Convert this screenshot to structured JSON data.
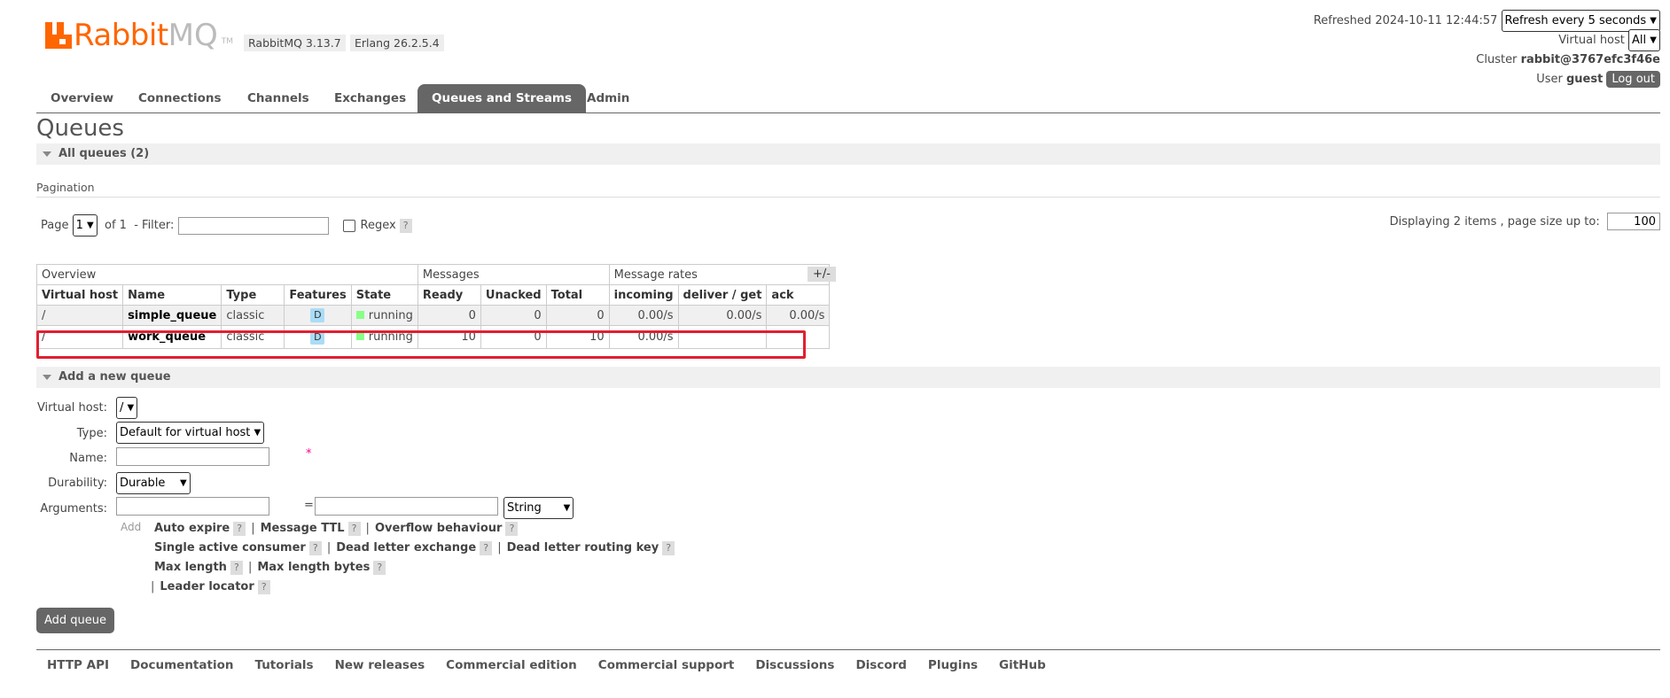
{
  "header": {
    "brand_rabbit": "Rabbit",
    "brand_mq": "MQ",
    "brand_tm": "TM",
    "rabbitmq_version": "RabbitMQ 3.13.7",
    "erlang_version": "Erlang 26.2.5.4",
    "refreshed_label": "Refreshed",
    "refreshed_time": "2024-10-11 12:44:57",
    "refresh_select": "Refresh every 5 seconds",
    "vhost_label": "Virtual host",
    "vhost_select": "All",
    "cluster_label": "Cluster",
    "cluster_name": "rabbit@3767efc3f46e",
    "user_label": "User",
    "user_name": "guest",
    "logout_label": "Log out"
  },
  "tabs": [
    {
      "label": "Overview"
    },
    {
      "label": "Connections"
    },
    {
      "label": "Channels"
    },
    {
      "label": "Exchanges"
    },
    {
      "label": "Queues and Streams",
      "active": true
    },
    {
      "label": "Admin"
    }
  ],
  "page_title": "Queues",
  "all_queues": {
    "label": "All queues (2)"
  },
  "pagination": {
    "title": "Pagination",
    "page_label": "Page",
    "page_value": "1",
    "of_label": "of 1",
    "filter_label": "- Filter:",
    "filter_value": "",
    "regex_label": "Regex",
    "help": "?",
    "displaying_label": "Displaying 2 items , page size up to:",
    "page_size": "100"
  },
  "table": {
    "groups": [
      "Overview",
      "Messages",
      "Message rates"
    ],
    "columns": [
      "Virtual host",
      "Name",
      "Type",
      "Features",
      "State",
      "Ready",
      "Unacked",
      "Total",
      "incoming",
      "deliver / get",
      "ack"
    ],
    "toggle": "+/-",
    "rows": [
      {
        "vhost": "/",
        "name": "simple_queue",
        "type": "classic",
        "feature": "D",
        "state": "running",
        "ready": "0",
        "unacked": "0",
        "total": "0",
        "incoming": "0.00/s",
        "deliver": "0.00/s",
        "ack": "0.00/s"
      },
      {
        "vhost": "/",
        "name": "work_queue",
        "type": "classic",
        "feature": "D",
        "state": "running",
        "ready": "10",
        "unacked": "0",
        "total": "10",
        "incoming": "0.00/s",
        "deliver": "",
        "ack": ""
      }
    ]
  },
  "add_queue": {
    "section_label": "Add a new queue",
    "vhost_label": "Virtual host:",
    "vhost_value": "/",
    "type_label": "Type:",
    "type_value": "Default for virtual host",
    "name_label": "Name:",
    "name_value": "",
    "required_mark": "*",
    "durability_label": "Durability:",
    "durability_value": "Durable",
    "arguments_label": "Arguments:",
    "arg_key": "",
    "equals": "=",
    "arg_value": "",
    "arg_type": "String",
    "add_label": "Add",
    "shortcuts": {
      "auto_expire": "Auto expire",
      "message_ttl": "Message TTL",
      "overflow": "Overflow behaviour",
      "single_active": "Single active consumer",
      "dlx": "Dead letter exchange",
      "dlrk": "Dead letter routing key",
      "max_length": "Max length",
      "max_length_bytes": "Max length bytes",
      "leader_locator": "Leader locator"
    },
    "submit_label": "Add queue"
  },
  "footer": [
    "HTTP API",
    "Documentation",
    "Tutorials",
    "New releases",
    "Commercial edition",
    "Commercial support",
    "Discussions",
    "Discord",
    "Plugins",
    "GitHub"
  ]
}
